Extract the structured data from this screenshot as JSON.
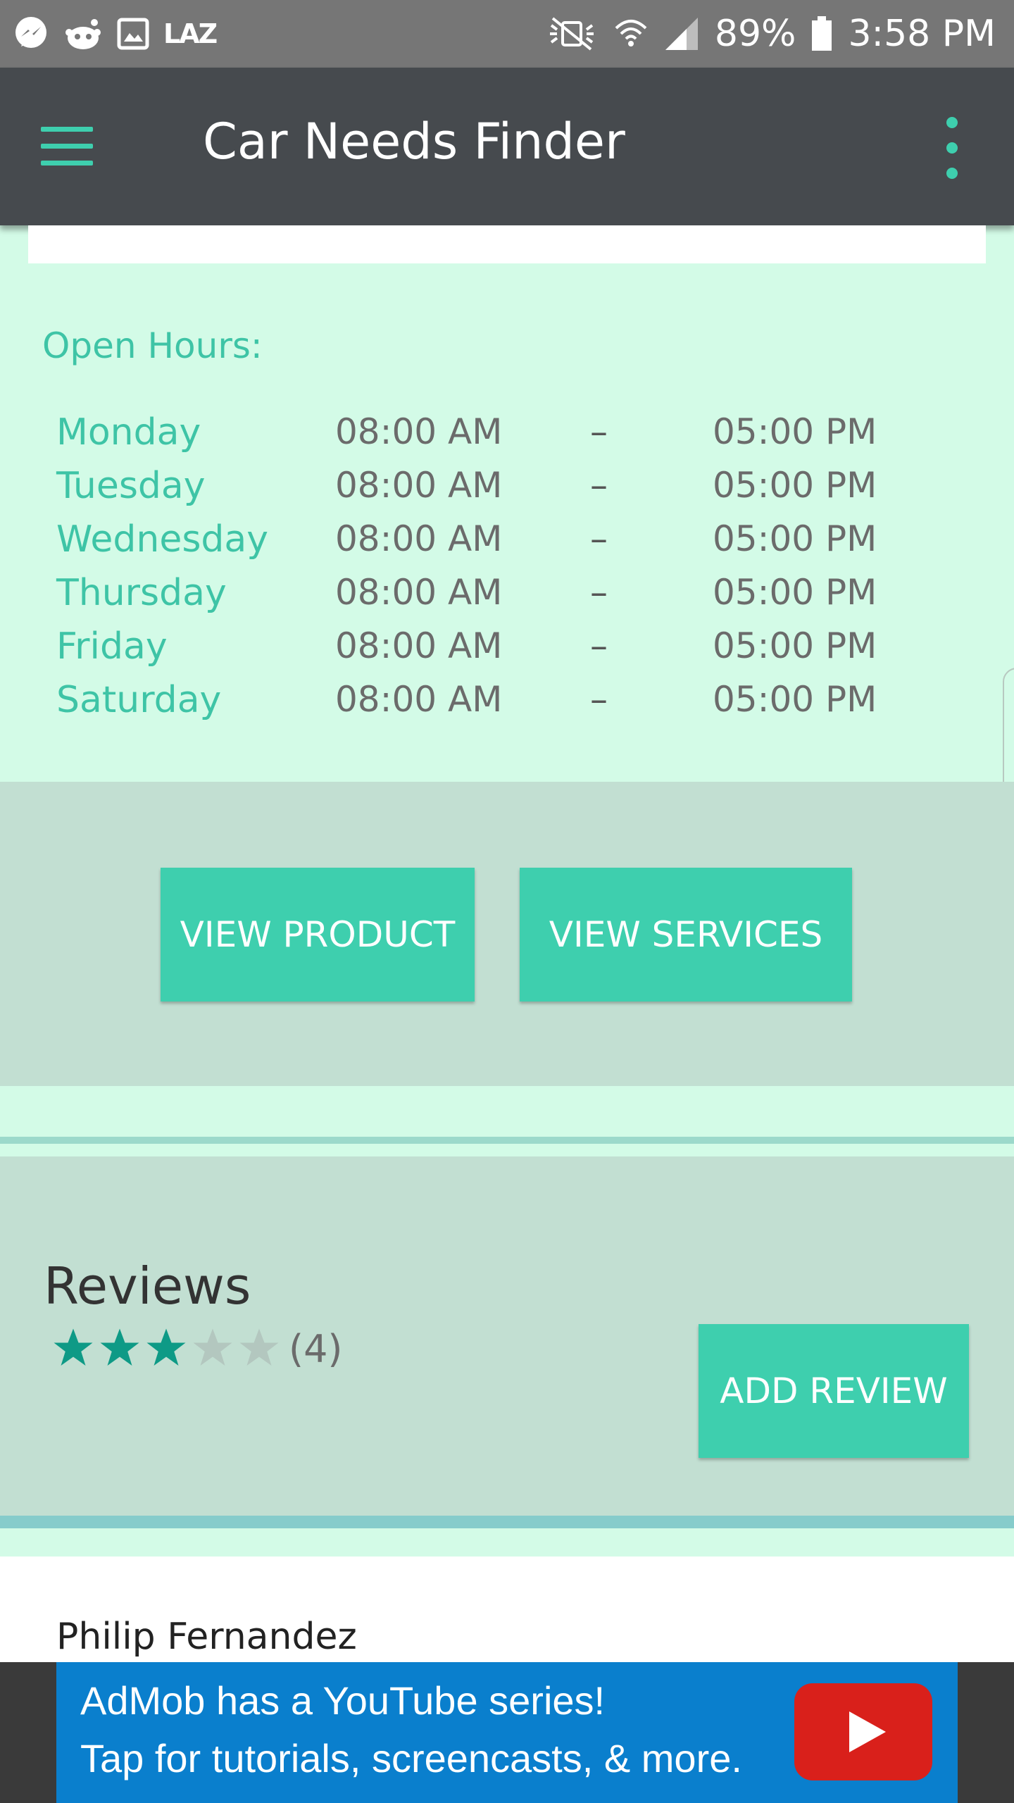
{
  "status_bar": {
    "carrier_label": "LAZ",
    "battery": "89%",
    "time": "3:58 PM",
    "icons": [
      "messenger-icon",
      "reddit-icon",
      "gallery-icon",
      "mute-icon",
      "wifi-icon",
      "signal-icon",
      "battery-icon"
    ]
  },
  "app_bar": {
    "title": "Car Needs Finder",
    "icons": [
      "menu-icon",
      "overflow-menu-icon"
    ]
  },
  "hours": {
    "label": "Open Hours:",
    "rows": [
      {
        "day": "Monday",
        "open": "08:00 AM",
        "sep": "–",
        "close": "05:00 PM"
      },
      {
        "day": "Tuesday",
        "open": "08:00 AM",
        "sep": "–",
        "close": "05:00 PM"
      },
      {
        "day": "Wednesday",
        "open": "08:00 AM",
        "sep": "–",
        "close": "05:00 PM"
      },
      {
        "day": "Thursday",
        "open": "08:00 AM",
        "sep": "–",
        "close": "05:00 PM"
      },
      {
        "day": "Friday",
        "open": "08:00 AM",
        "sep": "–",
        "close": "05:00 PM"
      },
      {
        "day": "Saturday",
        "open": "08:00 AM",
        "sep": "–",
        "close": "05:00 PM"
      }
    ]
  },
  "actions": {
    "view_product": "VIEW PRODUCT",
    "view_services": "VIEW SERVICES"
  },
  "reviews": {
    "title": "Reviews",
    "rating": 3,
    "max_rating": 5,
    "count": "(4)",
    "add_review": "ADD REVIEW",
    "first_reviewer": "Philip Fernandez"
  },
  "ad": {
    "line1": "AdMob has a YouTube series!",
    "line2": "Tap for tutorials, screencasts, & more.",
    "icon": "youtube-play-icon"
  },
  "colors": {
    "accent": "#3ecfae",
    "app_bar": "#464a4e",
    "background": "#d3fbe7",
    "band": "#c2dfd2",
    "star_filled": "#0e9a86",
    "star_empty": "#b3c7bf",
    "ad_blue": "#0a7fcd"
  }
}
